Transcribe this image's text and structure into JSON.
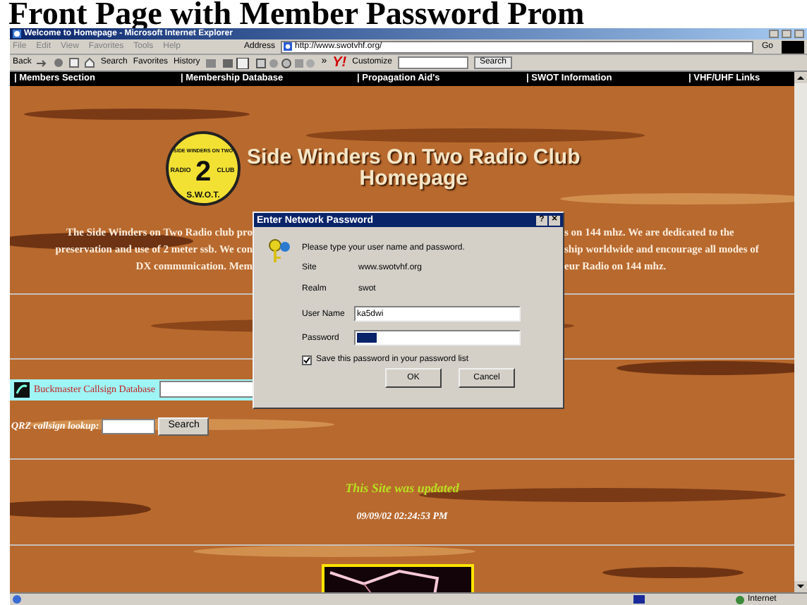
{
  "slide_title": "Front Page with Member Password Prom",
  "window": {
    "title": "Welcome to Homepage - Microsoft Internet Explorer"
  },
  "menu": [
    "File",
    "Edit",
    "View",
    "Favorites",
    "Tools",
    "Help"
  ],
  "address": {
    "label": "Address",
    "url": "http://www.swotvhf.org/",
    "go": "Go"
  },
  "toolbar": {
    "back": "Back",
    "search": "Search",
    "favorites": "Favorites",
    "history": "History",
    "yahoo": "Y!",
    "customize": "Customize",
    "search_button": "Search",
    "more": "»"
  },
  "nav": [
    "| Members Section",
    "| Membership Database",
    "| Propagation Aid's",
    "| SWOT Information",
    "| VHF/UHF Links"
  ],
  "logo": {
    "top": "SIDE WINDERS ON TWO",
    "left": "RADIO",
    "right": "CLUB",
    "center": "2",
    "bottom": "S.W.O.T."
  },
  "heading": [
    "Side Winders On Two Radio Club",
    "Homepage"
  ],
  "intro_left": [
    "The Side Winders on Two Radio club pro",
    "preservation and use of 2 meter ssb. We con",
    "DX communication. Mem"
  ],
  "intro_right": [
    "s on 144 mhz. We are dedicated to the",
    "ship worldwide and encourage all modes of",
    "eur Radio on 144 mhz."
  ],
  "buckmaster": {
    "label": "Buckmaster Callsign Database"
  },
  "qrz": {
    "label": "QRZ callsign lookup:",
    "button": "Search"
  },
  "updated": {
    "label": "This Site was updated",
    "time": "09/09/02 02:24:53 PM"
  },
  "dialog": {
    "title": "Enter Network Password",
    "help": "?",
    "close": "×",
    "prompt": "Please type your user name and password.",
    "info": [
      {
        "label": "Site",
        "value": "www.swotvhf.org"
      },
      {
        "label": "Realm",
        "value": "swot"
      }
    ],
    "inputs": [
      {
        "label": "User Name",
        "value": "ka5dwi",
        "selected": false
      },
      {
        "label": "Password",
        "selected": true
      }
    ],
    "save": {
      "label": "Save this password in your password list",
      "checked": true
    },
    "buttons": [
      "OK",
      "Cancel"
    ]
  },
  "status_bar": {
    "zone": "Internet"
  }
}
